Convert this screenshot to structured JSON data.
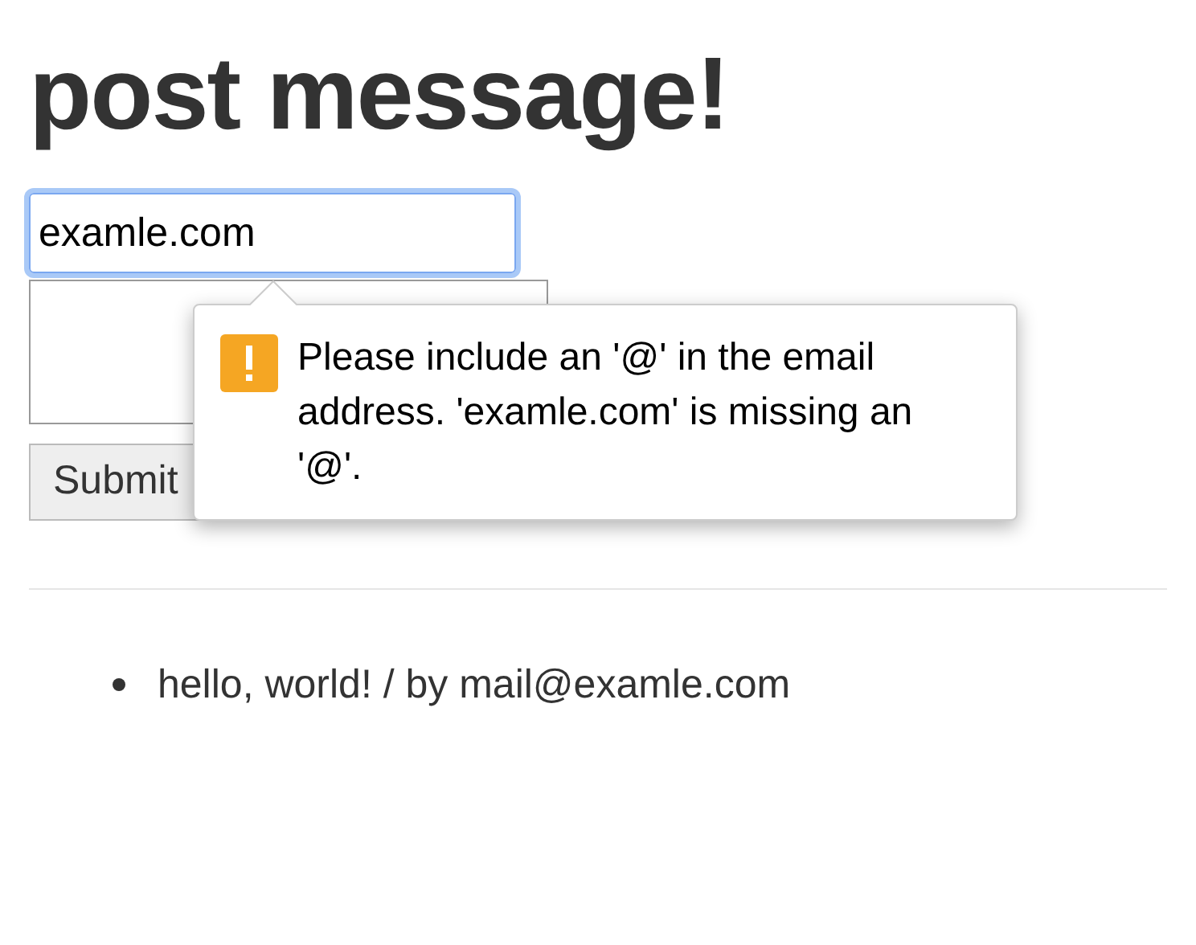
{
  "heading": "post message!",
  "email_field": {
    "value": "examle.com",
    "focused": true
  },
  "submit_button": {
    "label": "Submit"
  },
  "validation_tooltip": {
    "text": "Please include an '@' in the email address. 'examle.com' is missing an '@'."
  },
  "messages": [
    {
      "text": "hello, world! / by mail@examle.com"
    }
  ]
}
